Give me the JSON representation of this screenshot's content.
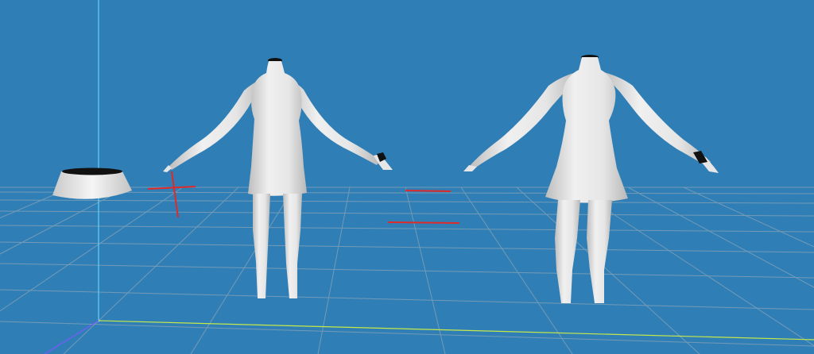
{
  "viewport": {
    "background": "#2f7fb6",
    "grid_color": "#8aa3b6",
    "axis_x_color": "#c6e84a",
    "axis_y_color": "#5fd3ff",
    "axis_z_color": "#7d58ff",
    "marker_color": "#e02a2a",
    "mesh_color": "#e8e8e8",
    "mesh_shade": "#bdbdbd",
    "mesh_dark": "#111111"
  },
  "objects": [
    {
      "name": "skirt-mesh"
    },
    {
      "name": "avatar-left"
    },
    {
      "name": "avatar-right"
    },
    {
      "name": "transform-gizmo"
    }
  ]
}
